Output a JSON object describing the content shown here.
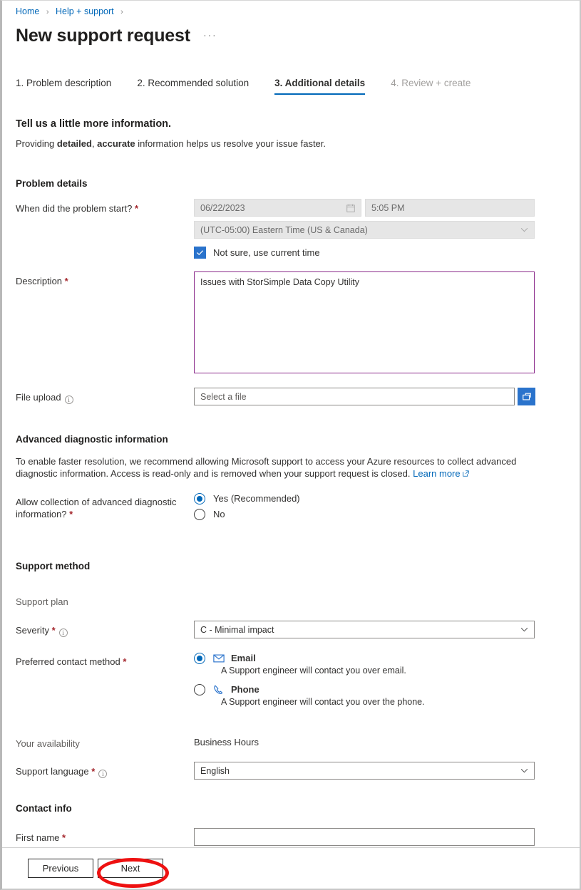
{
  "breadcrumb": {
    "items": [
      "Home",
      "Help + support"
    ],
    "separator": "›"
  },
  "header": {
    "title": "New support request",
    "more_label": "···"
  },
  "tabs": [
    {
      "label": "1. Problem description",
      "state": "done"
    },
    {
      "label": "2. Recommended solution",
      "state": "done"
    },
    {
      "label": "3. Additional details",
      "state": "active"
    },
    {
      "label": "4. Review + create",
      "state": "disabled"
    }
  ],
  "intro": {
    "heading": "Tell us a little more information.",
    "desc_1": "Providing ",
    "desc_b1": "detailed",
    "desc_2": ", ",
    "desc_b2": "accurate",
    "desc_3": " information helps us resolve your issue faster."
  },
  "problem_details": {
    "heading": "Problem details",
    "start_label": "When did the problem start?",
    "start_required": "*",
    "date_value": "06/22/2023",
    "time_value": "5:05 PM",
    "timezone_value": "(UTC-05:00) Eastern Time (US & Canada)",
    "not_sure_label": "Not sure, use current time",
    "not_sure_checked": true,
    "description_label": "Description",
    "description_required": "*",
    "description_value": "Issues with StorSimple Data Copy Utility",
    "file_upload_label": "File upload",
    "file_placeholder": "Select a file",
    "file_browse_icon": "folder-browse-icon"
  },
  "advanced": {
    "heading": "Advanced diagnostic information",
    "paragraph": "To enable faster resolution, we recommend allowing Microsoft support to access your Azure resources to collect advanced diagnostic information. Access is read-only and is removed when your support request is closed. ",
    "learn_more": "Learn more",
    "allow_label_line1": "Allow collection of advanced diagnostic",
    "allow_label_line2": "information?",
    "allow_required": "*",
    "options": [
      {
        "label": "Yes (Recommended)",
        "selected": true
      },
      {
        "label": "No",
        "selected": false
      }
    ]
  },
  "support_method": {
    "heading": "Support method",
    "support_plan_label": "Support plan",
    "support_plan_value": "",
    "severity_label": "Severity",
    "severity_required": "*",
    "severity_value": "C - Minimal impact",
    "contact_method_label": "Preferred contact method",
    "contact_method_required": "*",
    "contact_options": [
      {
        "name": "Email",
        "icon": "envelope-icon",
        "description": "A Support engineer will contact you over email.",
        "selected": true
      },
      {
        "name": "Phone",
        "icon": "phone-icon",
        "description": "A Support engineer will contact you over the phone.",
        "selected": false
      }
    ],
    "availability_label": "Your availability",
    "availability_value": "Business Hours",
    "language_label": "Support language",
    "language_required": "*",
    "language_value": "English"
  },
  "contact_info": {
    "heading": "Contact info",
    "first_name_label": "First name",
    "first_name_required": "*",
    "first_name_value": "",
    "first_name_placeholder": ""
  },
  "footer": {
    "previous_label": "Previous",
    "next_label": "Next"
  },
  "colors": {
    "link": "#0067b8",
    "accent": "#2a73cc",
    "required": "#a4262c",
    "textarea_focus_border": "#8b2a8b",
    "annotation": "#ee1111"
  }
}
